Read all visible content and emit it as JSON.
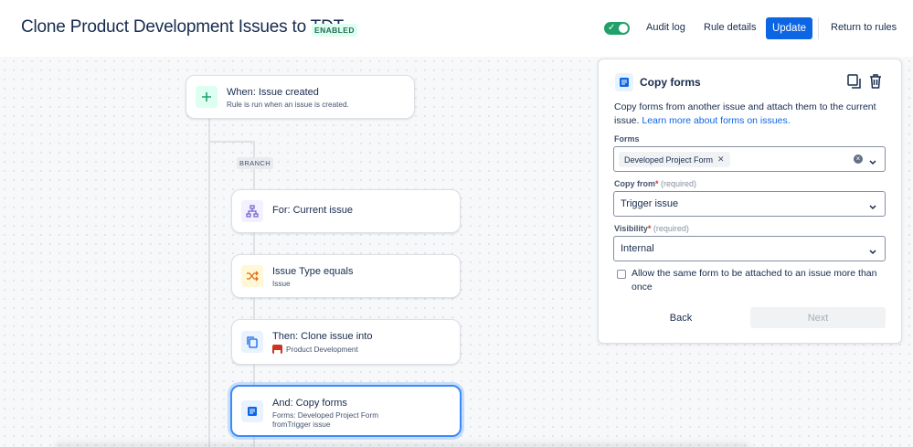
{
  "header": {
    "title": "Clone Product Development Issues to TDT",
    "status_badge": "ENABLED",
    "audit_log": "Audit log",
    "rule_details": "Rule details",
    "update": "Update",
    "return_to_rules": "Return to rules",
    "enabled_toggle_on": true
  },
  "flow": {
    "trigger": {
      "title": "When: Issue created",
      "subtitle": "Rule is run when an issue is created."
    },
    "branch_label": "BRANCH",
    "steps": [
      {
        "title": "For: Current issue",
        "icon": "branch-icon"
      },
      {
        "title": "Issue Type equals",
        "subtitle": "Issue",
        "icon": "shuffle-icon"
      },
      {
        "title": "Then: Clone issue into",
        "subtitle": "Product Development",
        "icon": "copy-icon"
      },
      {
        "title": "And: Copy forms",
        "subtitle": "Forms: Developed Project Form",
        "subtitle2": "fromTrigger issue",
        "icon": "form-icon",
        "selected": true
      }
    ]
  },
  "panel": {
    "title": "Copy forms",
    "description": "Copy forms from another issue and attach them to the current issue.",
    "learn_more": "Learn more about forms on issues.",
    "forms_label": "Forms",
    "forms_chip": "Developed Project Form",
    "copy_from_label": "Copy from",
    "copy_from_value": "Trigger issue",
    "visibility_label": "Visibility",
    "visibility_value": "Internal",
    "required_text": "(required)",
    "allow_same_form": "Allow the same form to be attached to an issue more than once",
    "back": "Back",
    "next": "Next"
  },
  "colors": {
    "primary": "#0c66e4",
    "toggle_on": "#22a06b",
    "badge_text": "#216e4e",
    "badge_bg": "#dcfff1",
    "selected_border": "#388bff"
  }
}
